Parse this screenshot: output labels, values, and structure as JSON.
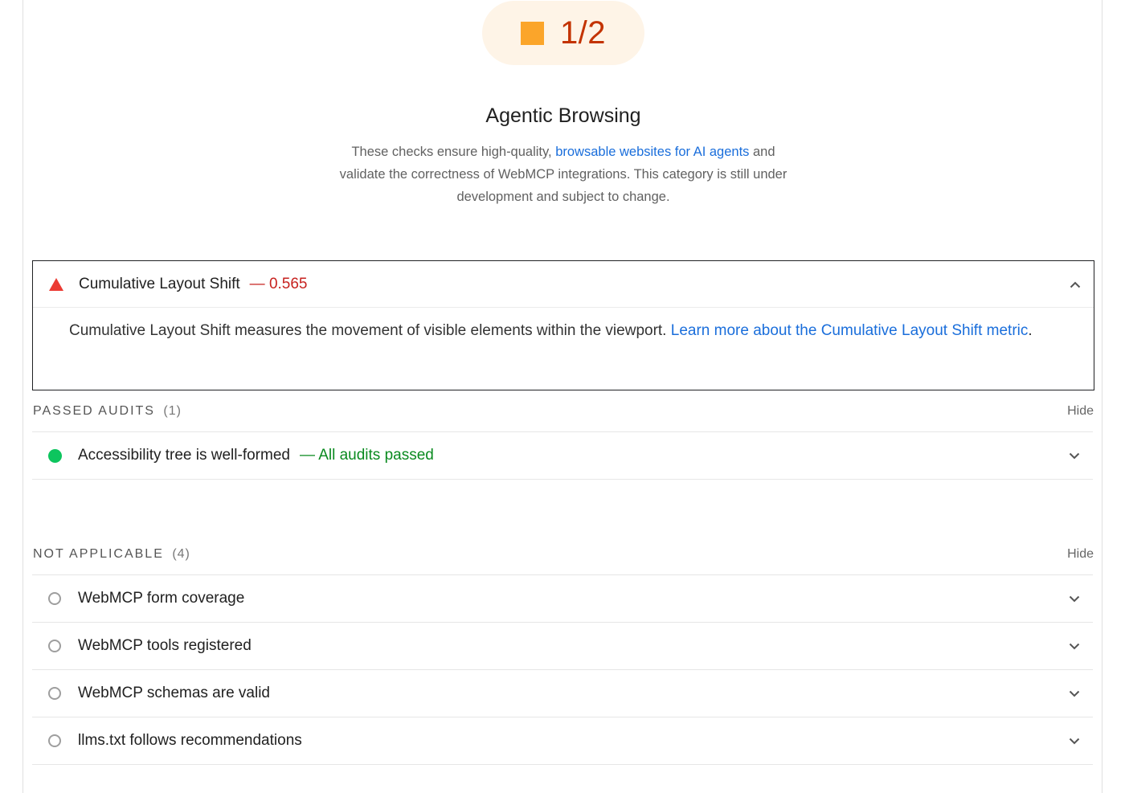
{
  "score": {
    "value": "1/2",
    "color": "#c33300",
    "badge_color": "#fba52a"
  },
  "category": {
    "title": "Agentic Browsing",
    "desc_before": "These checks ensure high-quality, ",
    "desc_link": "browsable websites for AI agents",
    "desc_after": " and validate the correctness of WebMCP integrations. This category is still under development and subject to change."
  },
  "expanded_audit": {
    "title": "Cumulative Layout Shift",
    "value": "— 0.565",
    "status": "fail",
    "description": "Cumulative Layout Shift measures the movement of visible elements within the viewport. ",
    "link": "Learn more about the Cumulative Layout Shift metric",
    "link_suffix": "."
  },
  "passed": {
    "title": "PASSED AUDITS",
    "count": "(1)",
    "hide_label": "Hide",
    "items": [
      {
        "title": "Accessibility tree is well-formed",
        "value": "— All audits passed",
        "status": "pass"
      }
    ]
  },
  "not_applicable": {
    "title": "NOT APPLICABLE",
    "count": "(4)",
    "hide_label": "Hide",
    "items": [
      {
        "title": "WebMCP form coverage"
      },
      {
        "title": "WebMCP tools registered"
      },
      {
        "title": "WebMCP schemas are valid"
      },
      {
        "title": "llms.txt follows recommendations"
      }
    ]
  }
}
